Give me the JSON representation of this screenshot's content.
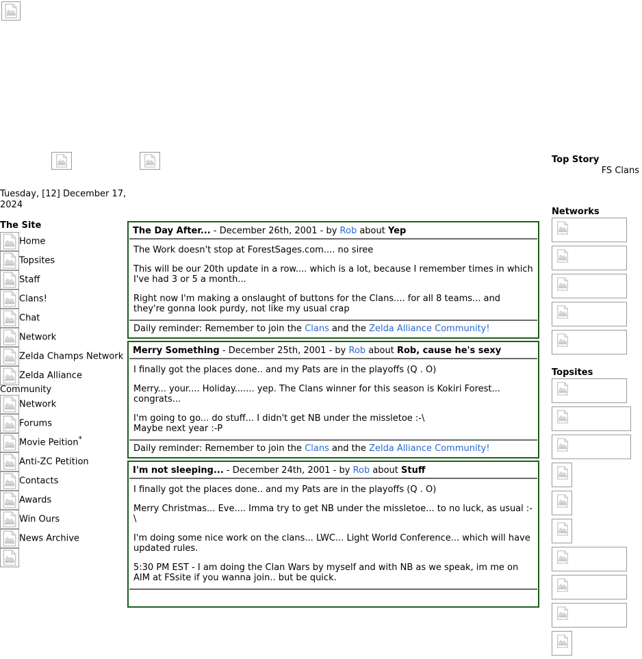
{
  "site": {
    "name": "ForestSages.com",
    "accent_border": "#1c5c1c",
    "link_color": "#2a6ad0",
    "rule_color": "#6b6b6b"
  },
  "date_stamp": "Tuesday, [12] December 17, 2024",
  "sidebar": {
    "heading": "The Site",
    "items": [
      {
        "label": "Home",
        "icon": "broken-image-icon",
        "star": ""
      },
      {
        "label": "Topsites",
        "icon": "broken-image-icon",
        "star": ""
      },
      {
        "label": "Staff",
        "icon": "broken-image-icon",
        "star": ""
      },
      {
        "label": "Clans!",
        "icon": "broken-image-icon",
        "star": ""
      },
      {
        "label": "Chat",
        "icon": "broken-image-icon",
        "star": ""
      },
      {
        "label": "Network",
        "icon": "broken-image-icon",
        "star": ""
      },
      {
        "label": "Zelda Champs Network",
        "icon": "broken-image-icon",
        "star": ""
      },
      {
        "label": "Zelda Alliance Community",
        "icon": "broken-image-icon",
        "star": ""
      },
      {
        "label": "Network",
        "icon": "broken-image-icon",
        "star": ""
      },
      {
        "label": "Forums",
        "icon": "broken-image-icon",
        "star": ""
      },
      {
        "label": "Movie Peition",
        "icon": "broken-image-icon",
        "star": "*"
      },
      {
        "label": "Anti-ZC Petition",
        "icon": "broken-image-icon",
        "star": ""
      },
      {
        "label": "Contacts",
        "icon": "broken-image-icon",
        "star": ""
      },
      {
        "label": "Awards",
        "icon": "broken-image-icon",
        "star": ""
      },
      {
        "label": "Win Ours",
        "icon": "broken-image-icon",
        "star": ""
      },
      {
        "label": "News Archive",
        "icon": "broken-image-icon",
        "star": ""
      },
      {
        "label": "",
        "icon": "broken-image-icon",
        "star": ""
      }
    ]
  },
  "banners": [
    {
      "icon": "broken-image-icon",
      "name": "site-logo-banner"
    },
    {
      "icon": "broken-image-icon",
      "name": "ad-banner-left"
    },
    {
      "icon": "broken-image-icon",
      "name": "ad-banner-right"
    }
  ],
  "posts": [
    {
      "title": "The Day After...",
      "dash1": " - ",
      "date": "December 26th, 2001",
      "dash2": " - by ",
      "author": "Rob",
      "about_label": " about ",
      "topic": "Yep",
      "paragraphs": [
        "The Work doesn't stop at ForestSages.com.... no siree",
        "This will be our 20th update in a row.... which is a lot, because I remember times in which I've had 3 or 5 a month...",
        "Right now I'm making a onslaught of buttons for the Clans.... for all 8 teams... and they're gonna look purdy, not like my usual crap"
      ],
      "footer": {
        "prefix": "Daily reminder: Remember to join the ",
        "link1": "Clans",
        "middle": " and the ",
        "link2": "Zelda Alliance Community!"
      }
    },
    {
      "title": "Merry Something",
      "dash1": " - ",
      "date": "December 25th, 2001",
      "dash2": " - by ",
      "author": "Rob",
      "about_label": " about ",
      "topic": "Rob, cause he's sexy",
      "paragraphs": [
        "I finally got the places done.. and my Pats are in the playoffs (Q . O)",
        "Merry... your.... Holiday....... yep. The Clans winner for this season is Kokiri Forest... congrats...",
        "I'm going to go... do stuff... I didn't get NB under the missletoe :-\\\nMaybe next year :-P"
      ],
      "footer": {
        "prefix": "Daily reminder: Remember to join the ",
        "link1": "Clans",
        "middle": " and the ",
        "link2": "Zelda Alliance Community!"
      }
    },
    {
      "title": "I'm not sleeping...",
      "dash1": " - ",
      "date": "December 24th, 2001",
      "dash2": " - by ",
      "author": "Rob",
      "about_label": " about ",
      "topic": "Stuff",
      "paragraphs": [
        "I finally got the places done.. and my Pats are in the playoffs (Q . O)",
        "Merry Christmas... Eve.... Imma try to get NB under the missletoe... to no luck, as usual :-\\",
        "I'm doing some nice work on the clans... LWC... Light World Conference... which will have updated rules.",
        "5:30 PM EST - I am doing the Clan Wars by myself and with NB as we speak, im me on AIM at FSsite if you wanna join.. but be quick."
      ],
      "footer": {
        "prefix": "",
        "link1": "",
        "middle": "",
        "link2": ""
      }
    }
  ],
  "right": {
    "top_story_heading": "Top Story",
    "top_story_value": "FS Clans",
    "networks_heading": "Networks",
    "networks": [
      {
        "icon": "broken-image-icon",
        "size": "w-full"
      },
      {
        "icon": "broken-image-icon",
        "size": "w-full"
      },
      {
        "icon": "broken-image-icon",
        "size": "w-full"
      },
      {
        "icon": "broken-image-icon",
        "size": "w-full"
      },
      {
        "icon": "broken-image-icon",
        "size": "w-full"
      }
    ],
    "topsites_heading": "Topsites",
    "topsites": [
      {
        "icon": "broken-image-icon",
        "size": "w-full"
      },
      {
        "icon": "broken-image-icon",
        "size": "w-mid"
      },
      {
        "icon": "broken-image-icon",
        "size": "w-mid"
      },
      {
        "icon": "broken-image-icon",
        "size": "w-sm"
      },
      {
        "icon": "broken-image-icon",
        "size": "w-sm"
      },
      {
        "icon": "broken-image-icon",
        "size": "w-sm"
      },
      {
        "icon": "broken-image-icon",
        "size": "w-full"
      },
      {
        "icon": "broken-image-icon",
        "size": "w-full"
      },
      {
        "icon": "broken-image-icon",
        "size": "w-full"
      },
      {
        "icon": "broken-image-icon",
        "size": "w-sm"
      }
    ]
  }
}
